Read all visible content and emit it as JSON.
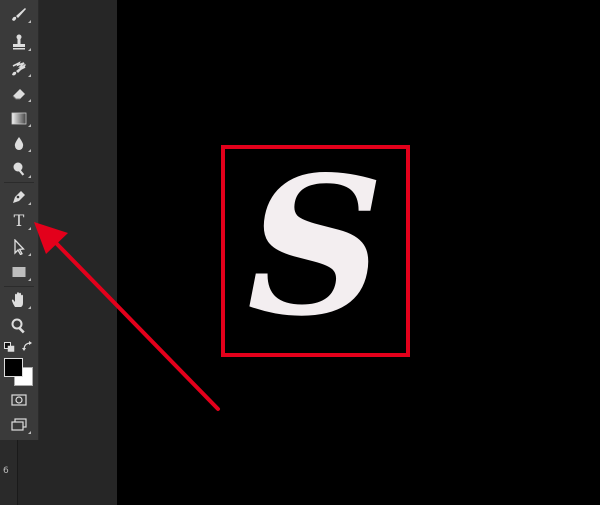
{
  "ruler": {
    "label": "6"
  },
  "tools": [
    {
      "icon": "brush-icon"
    },
    {
      "icon": "clone-stamp-icon"
    },
    {
      "icon": "history-brush-icon"
    },
    {
      "icon": "eraser-icon"
    },
    {
      "icon": "gradient-icon"
    },
    {
      "icon": "blur-icon"
    },
    {
      "icon": "dodge-icon"
    },
    {
      "icon": "pen-icon"
    },
    {
      "icon": "type-tool-icon",
      "label": "T"
    },
    {
      "icon": "path-selection-icon"
    },
    {
      "icon": "rectangle-icon"
    },
    {
      "icon": "hand-icon"
    },
    {
      "icon": "zoom-icon"
    },
    {
      "icon": "quick-mask-icon"
    },
    {
      "icon": "screen-mode-icon"
    }
  ],
  "swatches": {
    "foreground": "#000000",
    "background": "#ffffff"
  },
  "canvas": {
    "letter": "S",
    "highlight_color": "#e3001b",
    "background": "#000000"
  },
  "annotation": {
    "arrow_color": "#e3001b",
    "points_to": "type-tool-icon"
  }
}
